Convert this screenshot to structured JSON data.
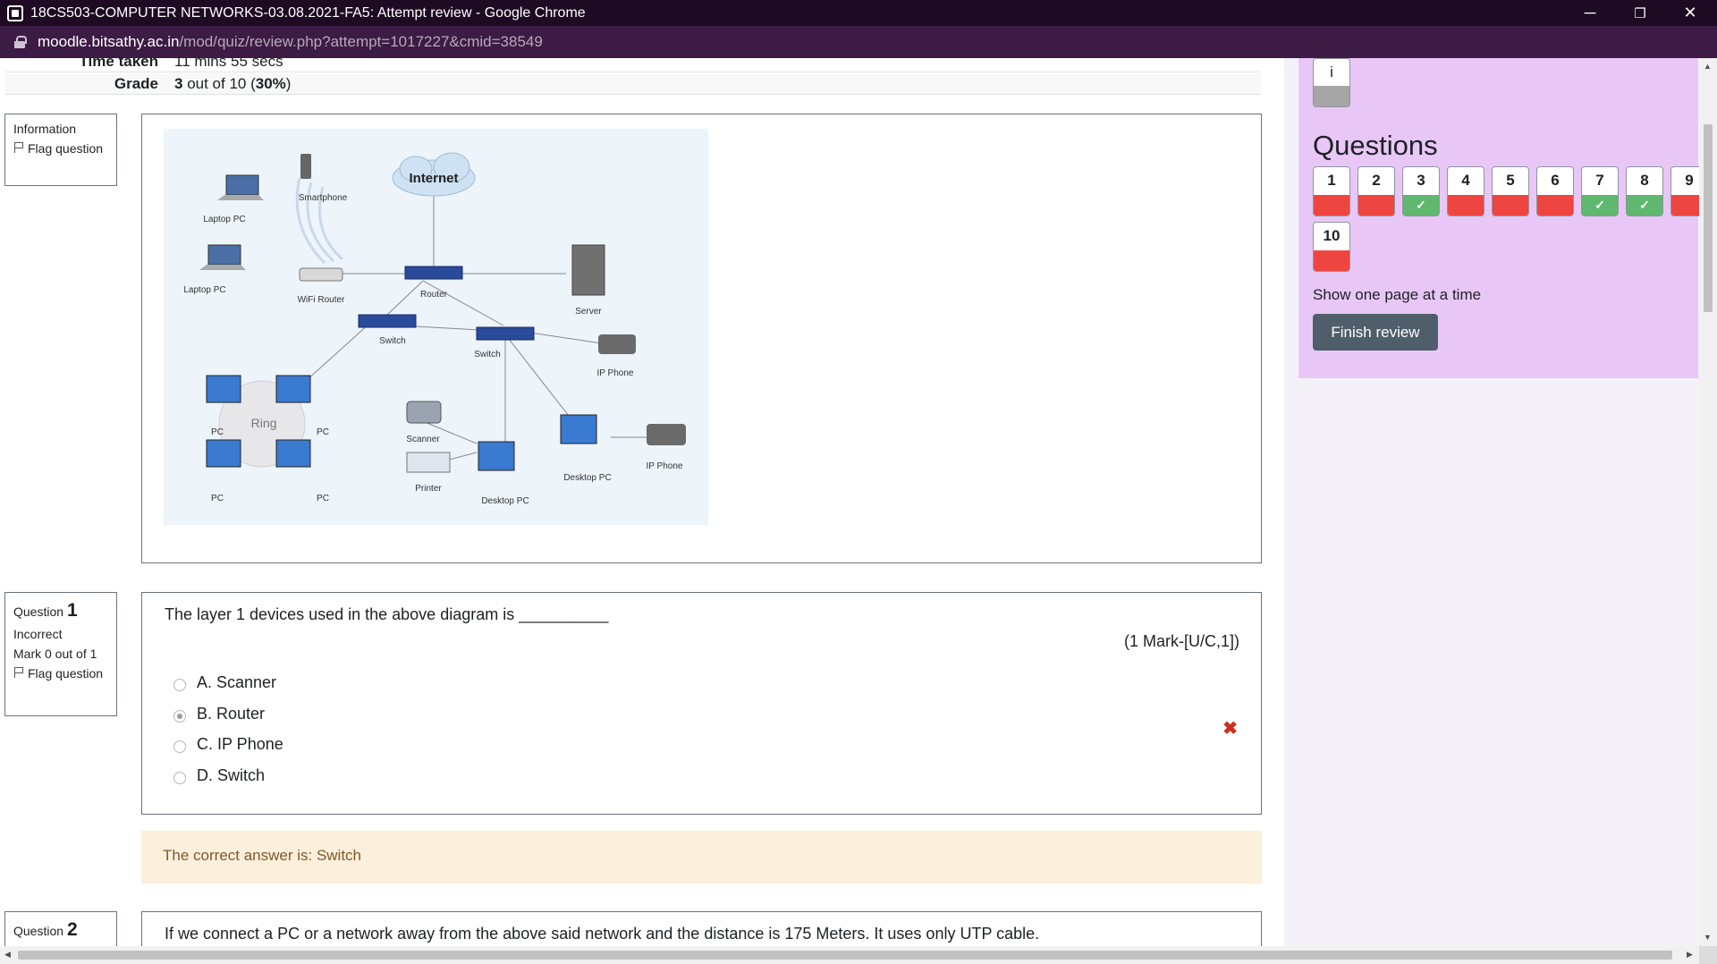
{
  "window": {
    "title": "18CS503-COMPUTER NETWORKS-03.08.2021-FA5: Attempt review - Google Chrome",
    "minimize": "─",
    "restore": "❐",
    "close": "✕"
  },
  "address": {
    "host": "moodle.bitsathy.ac.in",
    "path": "/mod/quiz/review.php?attempt=1017227&cmid=38549"
  },
  "summary": [
    {
      "label": "Time taken",
      "value": "11 mins 55 secs"
    },
    {
      "label": "Grade",
      "value_prefix": "3",
      "value_mid": " out of 10 (",
      "value_pct": "30%",
      "value_suffix": ")"
    }
  ],
  "info_block": {
    "label": "Information",
    "flag": "Flag question"
  },
  "diagram": {
    "labels": {
      "internet": "Internet",
      "smartphone": "Smartphone",
      "laptop1": "Laptop PC",
      "laptop2": "Laptop PC",
      "wifi": "WiFi Router",
      "router": "Router",
      "server": "Server",
      "switch1": "Switch",
      "switch2": "Switch",
      "ipphone1": "IP Phone",
      "ring": "Ring",
      "pc1": "PC",
      "pc2": "PC",
      "pc3": "PC",
      "pc4": "PC",
      "scanner": "Scanner",
      "printer": "Printer",
      "desktop1": "Desktop PC",
      "desktop2": "Desktop PC",
      "ipphone2": "IP Phone"
    }
  },
  "question1": {
    "label": "Question",
    "number": "1",
    "status": "Incorrect",
    "mark": "Mark 0 out of 1",
    "flag": "Flag question",
    "text": "The layer 1 devices used in the above diagram is __________",
    "marks": "(1 Mark-[U/C,1])",
    "options": [
      "A. Scanner",
      "B. Router",
      "C. IP Phone",
      "D. Switch"
    ],
    "selected": 1,
    "result_icon": "✖",
    "feedback": "The correct answer is: Switch"
  },
  "question2": {
    "label": "Question",
    "number": "2",
    "text": "If we connect a PC or a network away from the above said network and the distance is 175 Meters. It uses only UTP cable."
  },
  "nav": {
    "info_label": "i",
    "title": "Questions",
    "buttons": [
      {
        "n": "1",
        "state": "incorrect"
      },
      {
        "n": "2",
        "state": "incorrect"
      },
      {
        "n": "3",
        "state": "correct"
      },
      {
        "n": "4",
        "state": "incorrect"
      },
      {
        "n": "5",
        "state": "incorrect"
      },
      {
        "n": "6",
        "state": "incorrect"
      },
      {
        "n": "7",
        "state": "correct"
      },
      {
        "n": "8",
        "state": "correct"
      },
      {
        "n": "9",
        "state": "incorrect"
      },
      {
        "n": "10",
        "state": "incorrect"
      }
    ],
    "check": "✓",
    "show_one": "Show one page at a time",
    "finish": "Finish review"
  },
  "colors": {
    "incorrect": "#ef4540",
    "correct": "#5fb86d",
    "nav_bg": "#e8c7f6",
    "titlebar": "#1e0a22",
    "feedback_bg": "#fcefdc"
  }
}
